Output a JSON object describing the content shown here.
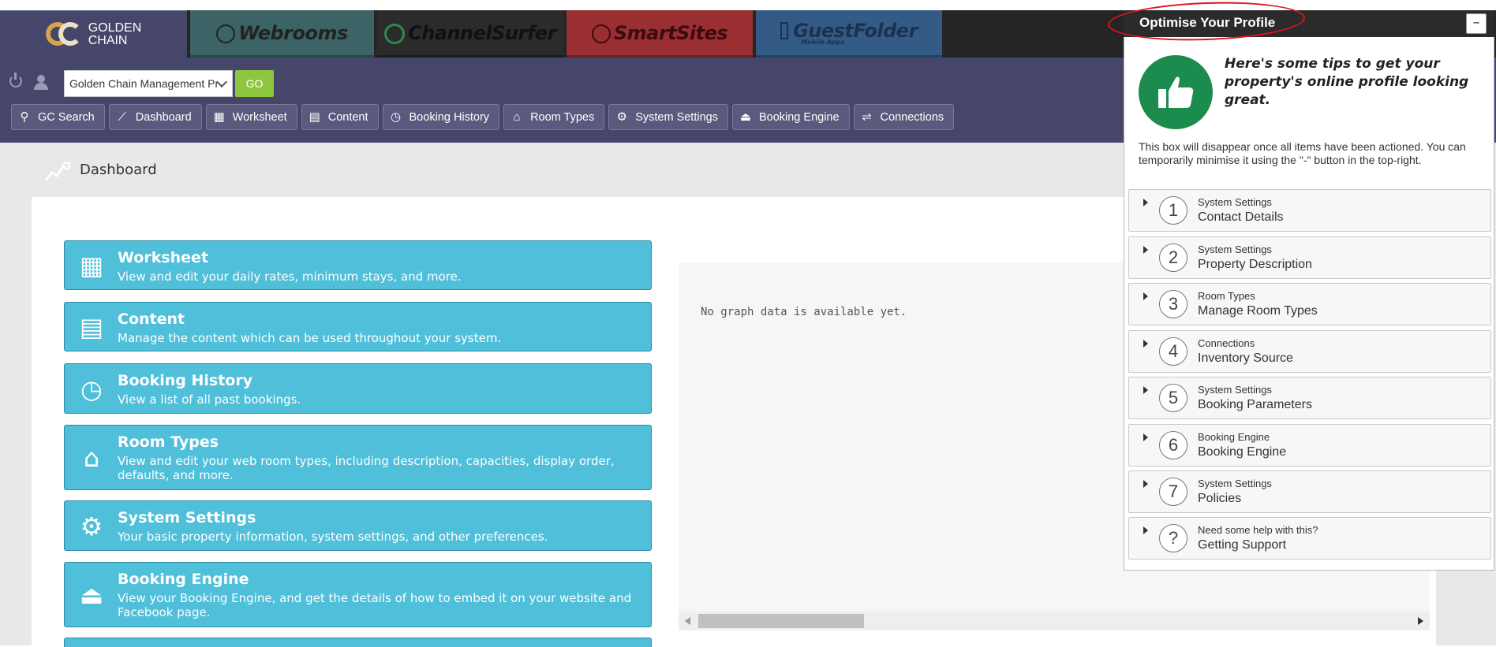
{
  "products": {
    "golden_chain_line1": "GOLDEN",
    "golden_chain_line2": "CHAIN",
    "webrooms": "Webrooms",
    "channelsurfer": "ChannelSurfer",
    "smartsites": "SmartSites",
    "guestfolder": "GuestFolder",
    "guestfolder_sub": "Mobile Apps"
  },
  "toolbar": {
    "property_select_value": "Golden Chain Management Pr",
    "go_label": "GO"
  },
  "nav": {
    "items": [
      {
        "label": "GC Search",
        "icon": "search-icon"
      },
      {
        "label": "Dashboard",
        "icon": "chart-line-icon"
      },
      {
        "label": "Worksheet",
        "icon": "grid-icon"
      },
      {
        "label": "Content",
        "icon": "document-icon"
      },
      {
        "label": "Booking History",
        "icon": "history-icon"
      },
      {
        "label": "Room Types",
        "icon": "house-icon"
      },
      {
        "label": "System Settings",
        "icon": "gear-icon"
      },
      {
        "label": "Booking Engine",
        "icon": "bell-icon"
      },
      {
        "label": "Connections",
        "icon": "connection-icon"
      }
    ]
  },
  "page": {
    "title": "Dashboard"
  },
  "tiles": [
    {
      "title": "Worksheet",
      "desc": "View and edit your daily rates, minimum stays, and more.",
      "icon": "grid-icon"
    },
    {
      "title": "Content",
      "desc": "Manage the content which can be used throughout your system.",
      "icon": "document-icon"
    },
    {
      "title": "Booking History",
      "desc": "View a list of all past bookings.",
      "icon": "history-icon"
    },
    {
      "title": "Room Types",
      "desc": "View and edit your web room types, including description, capacities, display order, defaults, and more.",
      "icon": "house-icon"
    },
    {
      "title": "System Settings",
      "desc": "Your basic property information, system settings, and other preferences.",
      "icon": "gear-icon"
    },
    {
      "title": "Booking Engine",
      "desc": "View your Booking Engine, and get the details of how to embed it on your website and Facebook page.",
      "icon": "bell-icon"
    }
  ],
  "graph": {
    "empty_message": "No graph data is available yet."
  },
  "optimise": {
    "title": "Optimise Your Profile",
    "minimise_label": "–",
    "tips_heading": "Here's some tips to get your property's online profile looking great.",
    "note": "This box will disappear once all items have been actioned. You can temporarily minimise it using the \"-\" button in the top-right.",
    "steps": [
      {
        "num": "1",
        "category": "System Settings",
        "label": "Contact Details"
      },
      {
        "num": "2",
        "category": "System Settings",
        "label": "Property Description"
      },
      {
        "num": "3",
        "category": "Room Types",
        "label": "Manage Room Types"
      },
      {
        "num": "4",
        "category": "Connections",
        "label": "Inventory Source"
      },
      {
        "num": "5",
        "category": "System Settings",
        "label": "Booking Parameters"
      },
      {
        "num": "6",
        "category": "Booking Engine",
        "label": "Booking Engine"
      },
      {
        "num": "7",
        "category": "System Settings",
        "label": "Policies"
      },
      {
        "num": "?",
        "category": "Need some help with this?",
        "label": "Getting Support"
      }
    ]
  },
  "colors": {
    "nav_bg": "#46466a",
    "tile_bg": "#4fbfda",
    "go_green": "#8dc63f",
    "thumbs_green": "#1b8c4d",
    "annotation_red": "#e0151b"
  }
}
